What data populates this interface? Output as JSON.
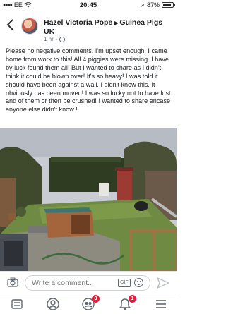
{
  "status_bar": {
    "carrier": "EE",
    "time": "20:45",
    "battery_percent": "87%",
    "battery_level": 0.87
  },
  "post": {
    "author": "Hazel Victoria Pope",
    "group": "Guinea Pigs UK",
    "time_ago": "1 hr",
    "text": "Please no negative comments. I'm upset enough. I came home from work to this! All 4 piggies were missing. I have by luck found them all! But I wanted to share as I didn't think it could be blown over! It's so heavy! I was told it should have been against a wall. I didn't know this. It obviously has been moved! I was so lucky not to have lost and of them or then be crushed! I wanted to share encase anyone else didn't know !"
  },
  "comment_bar": {
    "placeholder": "Write a comment...",
    "gif_label": "GIF",
    "icons": [
      "camera-icon",
      "emoji-icon",
      "send-icon"
    ]
  },
  "bottom_nav": {
    "items": [
      {
        "icon": "news-feed-icon"
      },
      {
        "icon": "profile-icon"
      },
      {
        "icon": "groups-icon",
        "badge": "3"
      },
      {
        "icon": "notifications-icon",
        "badge": "1"
      },
      {
        "icon": "menu-icon"
      }
    ]
  },
  "colors": {
    "accent": "#1877f2",
    "badge": "#e41e3f",
    "muted": "#606770"
  }
}
